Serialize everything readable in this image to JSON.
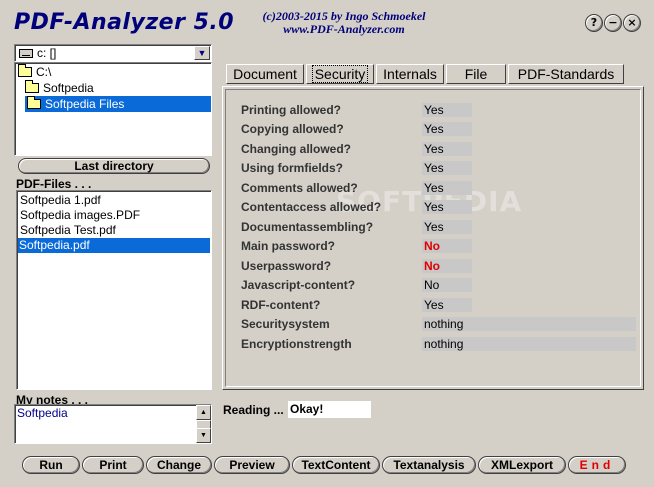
{
  "title": "PDF-Analyzer 5.0",
  "copyright_line1": "(c)2003-2015 by Ingo Schmoekel",
  "copyright_line2": "www.PDF-Analyzer.com",
  "window_buttons": {
    "help": "?",
    "minimize": "−",
    "close": "×"
  },
  "drive": {
    "value": "c: []"
  },
  "directories": [
    {
      "label": "C:\\"
    },
    {
      "label": "Softpedia"
    },
    {
      "label": "Softpedia Files",
      "selected": true
    }
  ],
  "last_directory_label": "Last directory",
  "files_label": "PDF-Files . . .",
  "files": [
    {
      "name": "Softpedia 1.pdf"
    },
    {
      "name": "Softpedia images.PDF"
    },
    {
      "name": "Softpedia Test.pdf"
    },
    {
      "name": "Softpedia.pdf",
      "selected": true
    }
  ],
  "notes_label": "My notes . . .",
  "notes_text": "Softpedia",
  "tabs": [
    {
      "label": "Document"
    },
    {
      "label": "Security",
      "active": true
    },
    {
      "label": "Internals"
    },
    {
      "label": "File"
    },
    {
      "label": "PDF-Standards"
    }
  ],
  "security": [
    {
      "label": "Printing allowed?",
      "value": "Yes"
    },
    {
      "label": "Copying allowed?",
      "value": "Yes"
    },
    {
      "label": "Changing allowed?",
      "value": "Yes"
    },
    {
      "label": "Using formfields?",
      "value": "Yes"
    },
    {
      "label": "Comments allowed?",
      "value": "Yes"
    },
    {
      "label": "Contentaccess allowed?",
      "value": "Yes"
    },
    {
      "label": "Documentassembling?",
      "value": "Yes"
    },
    {
      "label": "Main password?",
      "value": "No",
      "alert": true
    },
    {
      "label": "Userpassword?",
      "value": "No",
      "alert": true
    },
    {
      "label": "Javascript-content?",
      "value": "No"
    },
    {
      "label": "RDF-content?",
      "value": "Yes"
    },
    {
      "label": "Securitysystem",
      "value": "nothing",
      "wide": true
    },
    {
      "label": "Encryptionstrength",
      "value": "nothing",
      "wide": true
    }
  ],
  "watermark": "SOFTPEDIA",
  "reading_label": "Reading ...",
  "reading_value": "Okay!",
  "buttons": [
    {
      "label": "Run"
    },
    {
      "label": "Print"
    },
    {
      "label": "Change"
    },
    {
      "label": "Preview"
    },
    {
      "label": "TextContent"
    },
    {
      "label": "Textanalysis"
    },
    {
      "label": "XMLexport"
    },
    {
      "label": "End"
    }
  ]
}
